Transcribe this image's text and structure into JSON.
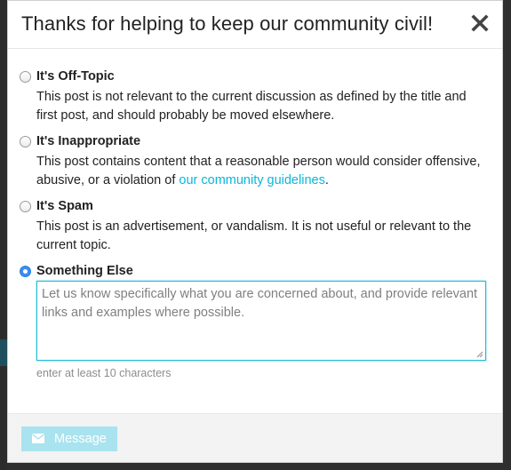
{
  "modal": {
    "title": "Thanks for helping to keep our community civil!",
    "close_icon": "close-icon"
  },
  "options": [
    {
      "title": "It's Off-Topic",
      "desc": "This post is not relevant to the current discussion as defined by the title and first post, and should probably be moved elsewhere.",
      "checked": false
    },
    {
      "title": "It's Inappropriate",
      "desc_prefix": "This post contains content that a reasonable person would consider offensive, abusive, or a violation of ",
      "link": "our community guidelines",
      "desc_suffix": ".",
      "checked": false
    },
    {
      "title": "It's Spam",
      "desc": "This post is an advertisement, or vandalism. It is not useful or relevant to the current topic.",
      "checked": false
    },
    {
      "title": "Something Else",
      "checked": true
    }
  ],
  "message": {
    "placeholder": "Let us know specifically what you are concerned about, and provide relevant links and examples where possible.",
    "value": "",
    "hint": "enter at least 10 characters"
  },
  "footer": {
    "button_label": "Message",
    "button_icon": "envelope-icon"
  },
  "colors": {
    "link": "#08b7d9",
    "textarea_focus": "#28b8d6",
    "button_disabled": "#a9e3ef",
    "radio_checked": "#3b8cf0"
  }
}
